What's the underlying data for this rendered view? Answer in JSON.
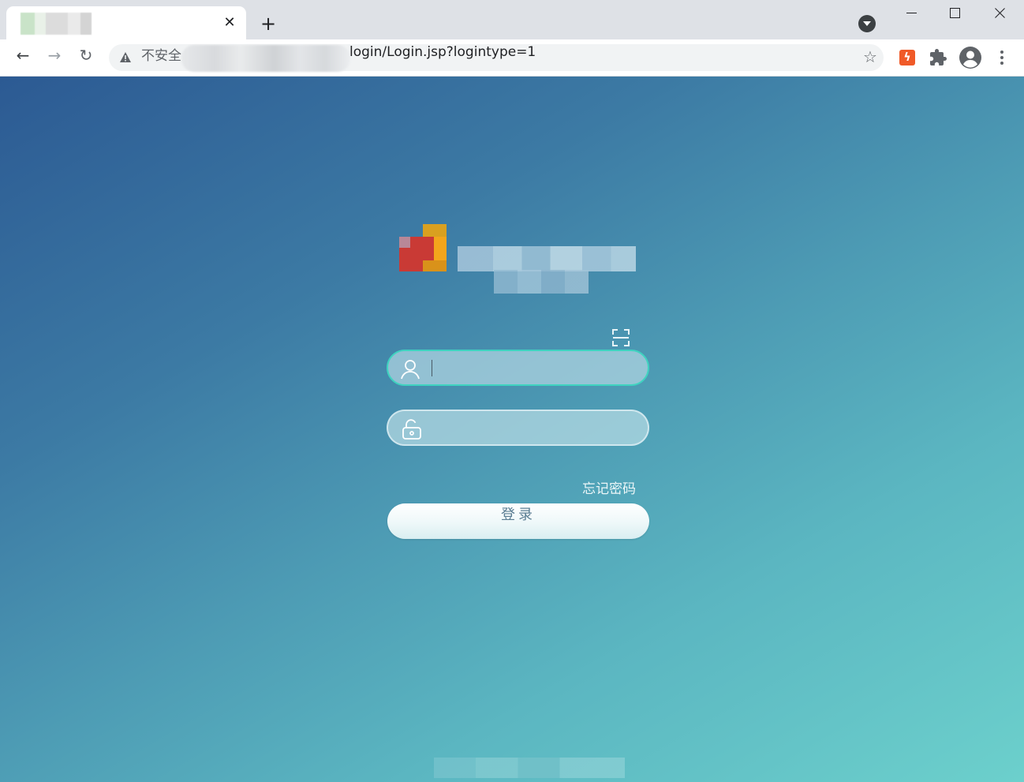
{
  "browser": {
    "tab": {
      "close_glyph": "✕"
    },
    "new_tab_glyph": "+",
    "nav": {
      "back_glyph": "←",
      "forward_glyph": "→",
      "reload_glyph": "↻"
    },
    "address_bar": {
      "security_label": "不安全",
      "url_visible": "login/Login.jsp?logintype=1"
    },
    "bookmark_glyph": "☆",
    "extension_glyph": "ϟ",
    "icons": [
      "tab-search-icon",
      "minimize-icon",
      "maximize-icon",
      "close-window-icon",
      "warning-icon",
      "star-icon",
      "extension-icon",
      "puzzle-icon",
      "profile-icon",
      "menu-icon"
    ]
  },
  "login": {
    "username": {
      "value": "",
      "placeholder": "",
      "icon": "user-icon"
    },
    "password": {
      "value": "",
      "placeholder": "",
      "icon": "unlock-icon"
    },
    "qr_icon": "qr-scan-icon",
    "forgot_password": "忘记密码",
    "submit_label": "登录"
  },
  "colors": {
    "bg_start": "#2c5a93",
    "bg_end": "#6cd0cc",
    "focus_border": "#3fd3c0",
    "button_text": "#5a7d92"
  }
}
